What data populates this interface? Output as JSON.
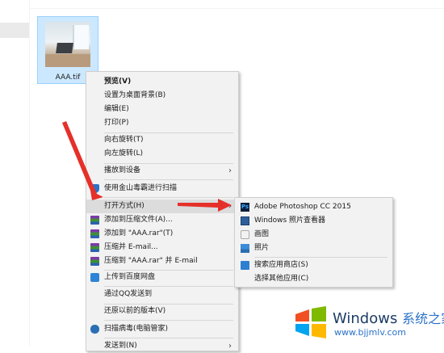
{
  "file": {
    "name": "AAA.tif",
    "thumbnail_icon": "image-thumbnail-icon"
  },
  "context_menu": {
    "items": [
      {
        "label": "预览(V)",
        "bold": true,
        "icon": ""
      },
      {
        "label": "设置为桌面背景(B)",
        "icon": ""
      },
      {
        "label": "编辑(E)",
        "icon": ""
      },
      {
        "label": "打印(P)",
        "icon": ""
      },
      {
        "label": "向右旋转(T)",
        "icon": ""
      },
      {
        "label": "向左旋转(L)",
        "icon": ""
      },
      {
        "label": "播放到设备",
        "icon": "",
        "submenu": true
      },
      {
        "label": "使用金山毒霸进行扫描",
        "icon": "shield-icon"
      },
      {
        "label": "打开方式(H)",
        "icon": "",
        "submenu": true,
        "highlighted": true
      },
      {
        "label": "添加到压缩文件(A)...",
        "icon": "winrar-icon"
      },
      {
        "label": "添加到 \"AAA.rar\"(T)",
        "icon": "winrar-icon"
      },
      {
        "label": "压缩并 E-mail...",
        "icon": "winrar-icon"
      },
      {
        "label": "压缩到 \"AAA.rar\" 并 E-mail",
        "icon": "winrar-icon"
      },
      {
        "label": "上传到百度网盘",
        "icon": "baidu-cloud-icon"
      },
      {
        "label": "通过QQ发送到",
        "icon": ""
      },
      {
        "label": "还原以前的版本(V)",
        "icon": ""
      },
      {
        "label": "扫描病毒(电脑管家)",
        "icon": "scan-icon"
      },
      {
        "label": "发送到(N)",
        "icon": "",
        "submenu": true
      }
    ]
  },
  "open_with_menu": {
    "items": [
      {
        "label": "Adobe Photoshop CC 2015",
        "icon": "photoshop-icon",
        "icon_text": "Ps"
      },
      {
        "label": "Windows 照片查看器",
        "icon": "photo-viewer-icon"
      },
      {
        "label": "画图",
        "icon": "paint-icon"
      },
      {
        "label": "照片",
        "icon": "photos-icon"
      },
      {
        "label": "搜索应用商店(S)",
        "icon": "store-icon"
      },
      {
        "label": "选择其他应用(C)",
        "icon": ""
      }
    ]
  },
  "watermark": {
    "title_en": "Windows",
    "title_cn": "系统之家",
    "url": "www.bjjmlv.com"
  },
  "colors": {
    "menu_bg": "#f2f2f2",
    "highlight": "#dcdcdc",
    "selection": "#cce8ff",
    "arrow_red": "#e5302a",
    "brand_blue": "#2a72c8"
  }
}
